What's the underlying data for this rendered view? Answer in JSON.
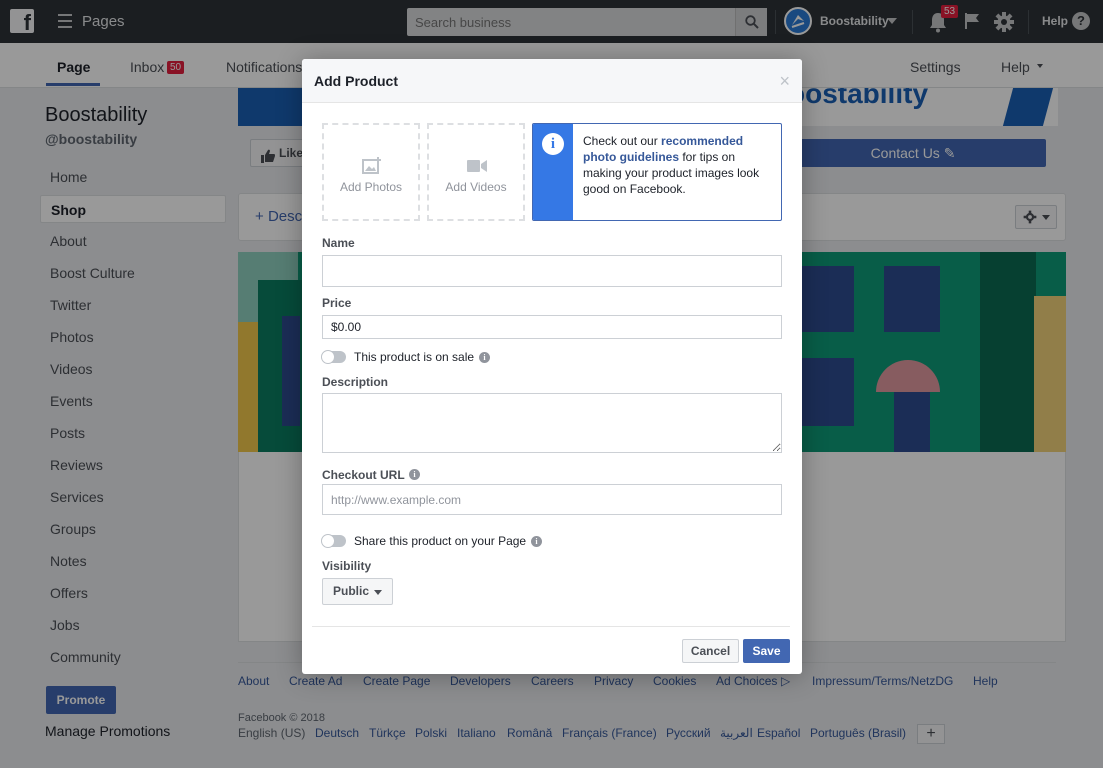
{
  "topbar": {
    "pages_label": "Pages",
    "search_placeholder": "Search business",
    "account_name": "Boostability",
    "notifications_count": "53",
    "help_label": "Help"
  },
  "pagebar": {
    "tabs": [
      {
        "label": "Page"
      },
      {
        "label": "Inbox"
      },
      {
        "label": "Notifications"
      },
      {
        "label": "Settings"
      },
      {
        "label": "Help"
      }
    ],
    "inbox_count": "50"
  },
  "sidebar": {
    "page_name": "Boostability",
    "handle": "@boostability",
    "items": [
      "Home",
      "Shop",
      "About",
      "Boost Culture",
      "Twitter",
      "Photos",
      "Videos",
      "Events",
      "Posts",
      "Reviews",
      "Services",
      "Groups",
      "Notes",
      "Offers",
      "Jobs",
      "Community"
    ],
    "promote_label": "Promote",
    "manage_promotions_label": "Manage Promotions"
  },
  "main": {
    "cover_text": "oostability",
    "like_label": "Like",
    "contact_label": "Contact Us",
    "description_add": "Desc"
  },
  "modal": {
    "title": "Add Product",
    "close": "×",
    "add_photos": "Add Photos",
    "add_videos": "Add Videos",
    "info_prefix": "Check out our ",
    "info_link": "recommended photo guidelines",
    "info_suffix": " for tips on making your product images look good on Facebook.",
    "name_label": "Name",
    "name_value": "",
    "price_label": "Price",
    "price_value": "$0.00",
    "sale_label": "This product is on sale",
    "description_label": "Description",
    "description_value": "",
    "checkout_label": "Checkout URL",
    "checkout_placeholder": "http://www.example.com",
    "share_label": "Share this product on your Page",
    "visibility_label": "Visibility",
    "visibility_value": "Public",
    "cancel_label": "Cancel",
    "save_label": "Save"
  },
  "footer": {
    "links": [
      "About",
      "Create Ad",
      "Create Page",
      "Developers",
      "Careers",
      "Privacy",
      "Cookies",
      "Ad Choices",
      "Impressum/Terms/NetzDG",
      "Help"
    ],
    "copyright": "Facebook © 2018",
    "languages": [
      "English (US)",
      "Deutsch",
      "Türkçe",
      "Polski",
      "Italiano",
      "Română",
      "Français (France)",
      "Русский",
      "العربية",
      "Español",
      "Português (Brasil)"
    ],
    "more_languages": "+"
  },
  "colors": {
    "brand_blue": "#4267b2",
    "topbar": "#2e3338",
    "badge_red": "#e41e3f",
    "info_blue": "#3578e5"
  }
}
